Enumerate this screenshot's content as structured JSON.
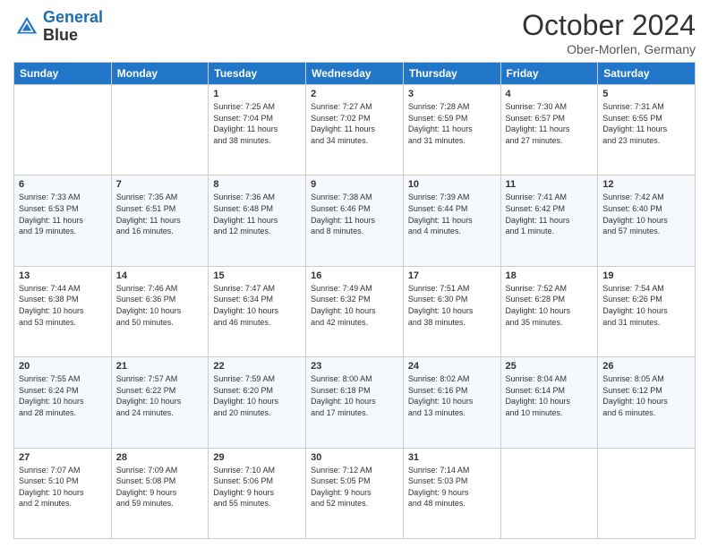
{
  "logo": {
    "line1": "General",
    "line2": "Blue"
  },
  "header": {
    "month": "October 2024",
    "location": "Ober-Morlen, Germany"
  },
  "weekdays": [
    "Sunday",
    "Monday",
    "Tuesday",
    "Wednesday",
    "Thursday",
    "Friday",
    "Saturday"
  ],
  "weeks": [
    [
      {
        "day": "",
        "info": ""
      },
      {
        "day": "",
        "info": ""
      },
      {
        "day": "1",
        "info": "Sunrise: 7:25 AM\nSunset: 7:04 PM\nDaylight: 11 hours\nand 38 minutes."
      },
      {
        "day": "2",
        "info": "Sunrise: 7:27 AM\nSunset: 7:02 PM\nDaylight: 11 hours\nand 34 minutes."
      },
      {
        "day": "3",
        "info": "Sunrise: 7:28 AM\nSunset: 6:59 PM\nDaylight: 11 hours\nand 31 minutes."
      },
      {
        "day": "4",
        "info": "Sunrise: 7:30 AM\nSunset: 6:57 PM\nDaylight: 11 hours\nand 27 minutes."
      },
      {
        "day": "5",
        "info": "Sunrise: 7:31 AM\nSunset: 6:55 PM\nDaylight: 11 hours\nand 23 minutes."
      }
    ],
    [
      {
        "day": "6",
        "info": "Sunrise: 7:33 AM\nSunset: 6:53 PM\nDaylight: 11 hours\nand 19 minutes."
      },
      {
        "day": "7",
        "info": "Sunrise: 7:35 AM\nSunset: 6:51 PM\nDaylight: 11 hours\nand 16 minutes."
      },
      {
        "day": "8",
        "info": "Sunrise: 7:36 AM\nSunset: 6:48 PM\nDaylight: 11 hours\nand 12 minutes."
      },
      {
        "day": "9",
        "info": "Sunrise: 7:38 AM\nSunset: 6:46 PM\nDaylight: 11 hours\nand 8 minutes."
      },
      {
        "day": "10",
        "info": "Sunrise: 7:39 AM\nSunset: 6:44 PM\nDaylight: 11 hours\nand 4 minutes."
      },
      {
        "day": "11",
        "info": "Sunrise: 7:41 AM\nSunset: 6:42 PM\nDaylight: 11 hours\nand 1 minute."
      },
      {
        "day": "12",
        "info": "Sunrise: 7:42 AM\nSunset: 6:40 PM\nDaylight: 10 hours\nand 57 minutes."
      }
    ],
    [
      {
        "day": "13",
        "info": "Sunrise: 7:44 AM\nSunset: 6:38 PM\nDaylight: 10 hours\nand 53 minutes."
      },
      {
        "day": "14",
        "info": "Sunrise: 7:46 AM\nSunset: 6:36 PM\nDaylight: 10 hours\nand 50 minutes."
      },
      {
        "day": "15",
        "info": "Sunrise: 7:47 AM\nSunset: 6:34 PM\nDaylight: 10 hours\nand 46 minutes."
      },
      {
        "day": "16",
        "info": "Sunrise: 7:49 AM\nSunset: 6:32 PM\nDaylight: 10 hours\nand 42 minutes."
      },
      {
        "day": "17",
        "info": "Sunrise: 7:51 AM\nSunset: 6:30 PM\nDaylight: 10 hours\nand 38 minutes."
      },
      {
        "day": "18",
        "info": "Sunrise: 7:52 AM\nSunset: 6:28 PM\nDaylight: 10 hours\nand 35 minutes."
      },
      {
        "day": "19",
        "info": "Sunrise: 7:54 AM\nSunset: 6:26 PM\nDaylight: 10 hours\nand 31 minutes."
      }
    ],
    [
      {
        "day": "20",
        "info": "Sunrise: 7:55 AM\nSunset: 6:24 PM\nDaylight: 10 hours\nand 28 minutes."
      },
      {
        "day": "21",
        "info": "Sunrise: 7:57 AM\nSunset: 6:22 PM\nDaylight: 10 hours\nand 24 minutes."
      },
      {
        "day": "22",
        "info": "Sunrise: 7:59 AM\nSunset: 6:20 PM\nDaylight: 10 hours\nand 20 minutes."
      },
      {
        "day": "23",
        "info": "Sunrise: 8:00 AM\nSunset: 6:18 PM\nDaylight: 10 hours\nand 17 minutes."
      },
      {
        "day": "24",
        "info": "Sunrise: 8:02 AM\nSunset: 6:16 PM\nDaylight: 10 hours\nand 13 minutes."
      },
      {
        "day": "25",
        "info": "Sunrise: 8:04 AM\nSunset: 6:14 PM\nDaylight: 10 hours\nand 10 minutes."
      },
      {
        "day": "26",
        "info": "Sunrise: 8:05 AM\nSunset: 6:12 PM\nDaylight: 10 hours\nand 6 minutes."
      }
    ],
    [
      {
        "day": "27",
        "info": "Sunrise: 7:07 AM\nSunset: 5:10 PM\nDaylight: 10 hours\nand 2 minutes."
      },
      {
        "day": "28",
        "info": "Sunrise: 7:09 AM\nSunset: 5:08 PM\nDaylight: 9 hours\nand 59 minutes."
      },
      {
        "day": "29",
        "info": "Sunrise: 7:10 AM\nSunset: 5:06 PM\nDaylight: 9 hours\nand 55 minutes."
      },
      {
        "day": "30",
        "info": "Sunrise: 7:12 AM\nSunset: 5:05 PM\nDaylight: 9 hours\nand 52 minutes."
      },
      {
        "day": "31",
        "info": "Sunrise: 7:14 AM\nSunset: 5:03 PM\nDaylight: 9 hours\nand 48 minutes."
      },
      {
        "day": "",
        "info": ""
      },
      {
        "day": "",
        "info": ""
      }
    ]
  ]
}
